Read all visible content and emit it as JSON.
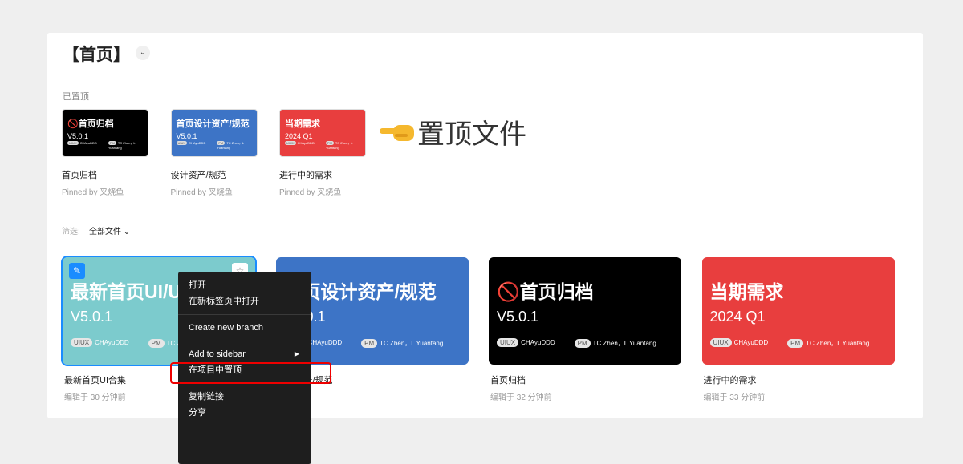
{
  "header": {
    "title": "【首页】",
    "chevron": "⌄"
  },
  "pinned": {
    "label": "已置顶",
    "items": [
      {
        "thumb_title": "🚫首页归档",
        "thumb_version": "V5.0.1",
        "tag1": "UIUX",
        "person1": "CHAyuDDD",
        "tag2": "PM",
        "person2": "TC Zhen，L Yuantang",
        "name": "首页归档",
        "by": "Pinned by 叉烧鱼",
        "color": "#000000"
      },
      {
        "thumb_title": "首页设计资产/规范",
        "thumb_version": "V5.0.1",
        "tag1": "UIUX",
        "person1": "CHAyuDDD",
        "tag2": "PM",
        "person2": "TC Zhen，L Yuantang",
        "name": "设计资产/规范",
        "by": "Pinned by 叉烧鱼",
        "color": "#3d74c6"
      },
      {
        "thumb_title": "当期需求",
        "thumb_version": "2024 Q1",
        "tag1": "UIUX",
        "person1": "CHAyuDDD",
        "tag2": "PM",
        "person2": "TC Zhen，L Yuantang",
        "name": "进行中的需求",
        "by": "Pinned by 叉烧鱼",
        "color": "#e83e3e"
      }
    ]
  },
  "annotation": {
    "icon": "pointing-left-hand",
    "text": "置顶文件"
  },
  "filter": {
    "label": "筛选:",
    "value": "全部文件 ⌄"
  },
  "files": [
    {
      "thumb_title": "最新首页UI/UX合集",
      "thumb_version": "V5.0.1",
      "tag1": "UIUX",
      "person1": "CHAyuDDD",
      "tag2": "PM",
      "person2": "TC Zhen，L Yuantang",
      "name": "最新首页UI合集",
      "meta": "编辑于 30 分钟前",
      "color": "#7ccbcd"
    },
    {
      "thumb_title": "首页设计资产/规范",
      "thumb_version": "V5.0.1",
      "tag1": "UIUX",
      "person1": "CHAyuDDD",
      "tag2": "PM",
      "person2": "TC Zhen，L Yuantang",
      "name": "设计资产/规范",
      "meta": "分钟前",
      "color": "#3d74c6"
    },
    {
      "thumb_title": "🚫首页归档",
      "thumb_version": "V5.0.1",
      "tag1": "UIUX",
      "person1": "CHAyuDDD",
      "tag2": "PM",
      "person2": "TC Zhen，L Yuantang",
      "name": "首页归档",
      "meta": "编辑于 32 分钟前",
      "color": "#000000"
    },
    {
      "thumb_title": "当期需求",
      "thumb_version": "2024 Q1",
      "tag1": "UIUX",
      "person1": "CHAyuDDD",
      "tag2": "PM",
      "person2": "TC Zhen，L Yuantang",
      "name": "进行中的需求",
      "meta": "编辑于 33 分钟前",
      "color": "#e83e3e"
    }
  ],
  "context_menu": {
    "open": "打开",
    "open_new_tab": "在新标签页中打开",
    "create_branch": "Create new branch",
    "add_sidebar": "Add to sidebar",
    "add_sidebar_arrow": "▶",
    "pin_in_project": "在项目中置顶",
    "copy_link": "复制链接",
    "share": "分享"
  },
  "icons": {
    "badge": "✎",
    "star": "☆"
  }
}
